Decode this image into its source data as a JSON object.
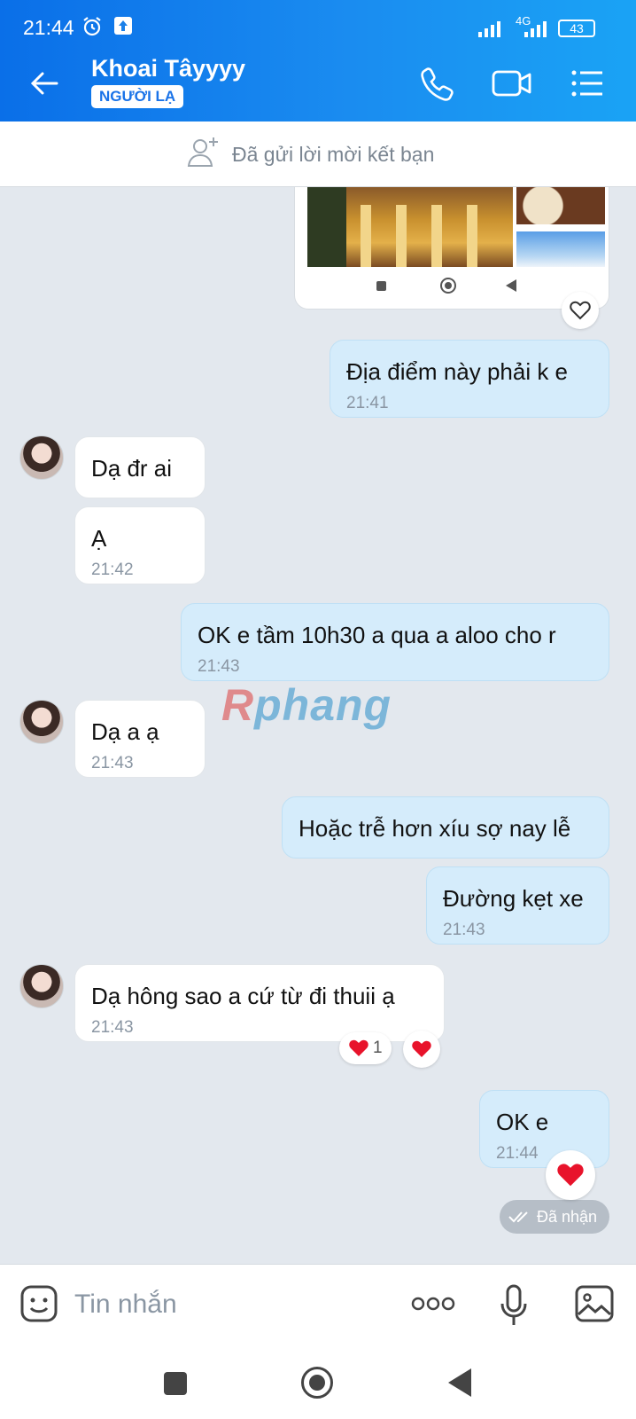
{
  "status": {
    "time": "21:44",
    "network": "4G",
    "battery": "43"
  },
  "header": {
    "name": "Khoai Tâyyyy",
    "badge": "NGƯỜI LẠ"
  },
  "friend_request": {
    "text": "Đã gửi lời mời kết bạn"
  },
  "messages": [
    {
      "dir": "out",
      "text": "Địa điểm này phải k e",
      "time": "21:41"
    },
    {
      "dir": "in",
      "text": "Dạ đr ai",
      "time": ""
    },
    {
      "dir": "in",
      "text": "Ạ",
      "time": "21:42"
    },
    {
      "dir": "out",
      "text": "OK e tầm 10h30 a qua a aloo cho r",
      "time": "21:43"
    },
    {
      "dir": "in",
      "text": "Dạ a ạ",
      "time": "21:43"
    },
    {
      "dir": "out",
      "text": "Hoặc trễ hơn xíu sợ nay lễ",
      "time": ""
    },
    {
      "dir": "out",
      "text": "Đường kẹt xe",
      "time": "21:43"
    },
    {
      "dir": "in",
      "text": "Dạ hông sao a cứ từ đi thuii ạ",
      "time": "21:43"
    },
    {
      "dir": "out",
      "text": "OK e",
      "time": "21:44"
    }
  ],
  "reactions": {
    "count": "1"
  },
  "seen_label": "Đã nhận",
  "watermark": {
    "part1": "R",
    "part2": "phang"
  },
  "input": {
    "placeholder": "Tin nhắn"
  },
  "colors": {
    "accent": "#1a8cf0",
    "out_bubble": "#d5ecfb",
    "heart": "#e8132b"
  }
}
